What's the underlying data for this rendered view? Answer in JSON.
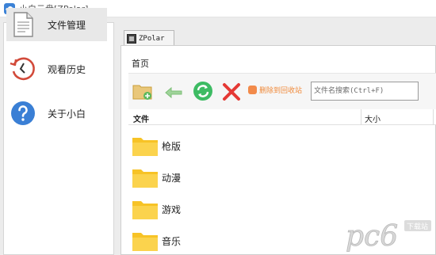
{
  "window": {
    "title": "小白云盘[ZPolar]"
  },
  "sidebar": {
    "items": [
      {
        "label": "文件管理",
        "icon": "document-icon",
        "active": true
      },
      {
        "label": "观看历史",
        "icon": "history-clock-icon",
        "active": false
      },
      {
        "label": "关于小白",
        "icon": "help-question-icon",
        "active": false
      }
    ]
  },
  "tabs": [
    {
      "label": "ZPolar",
      "icon": "polar-tab-icon"
    }
  ],
  "breadcrumb": "首页",
  "toolbar": {
    "new_folder": "new-folder-icon",
    "back": "back-arrow-icon",
    "refresh": "refresh-icon",
    "delete": "delete-x-icon",
    "recycle_label": "删除到回收站",
    "search_placeholder": "文件名搜索(Ctrl+F)"
  },
  "list": {
    "columns": [
      "文件",
      "大小"
    ],
    "rows": [
      {
        "name": "枪版",
        "size": ""
      },
      {
        "name": "动漫",
        "size": ""
      },
      {
        "name": "游戏",
        "size": ""
      },
      {
        "name": "音乐",
        "size": ""
      }
    ]
  },
  "watermark": {
    "text": "pc6",
    "sub": "下载站"
  },
  "colors": {
    "accent_blue": "#3b82d6",
    "folder_yellow": "#f7c326",
    "refresh_green": "#3dbb63",
    "delete_red": "#e53935",
    "recycle_orange": "#f08a3a",
    "history_red": "#d24a3a",
    "help_blue": "#3a7fd5"
  }
}
